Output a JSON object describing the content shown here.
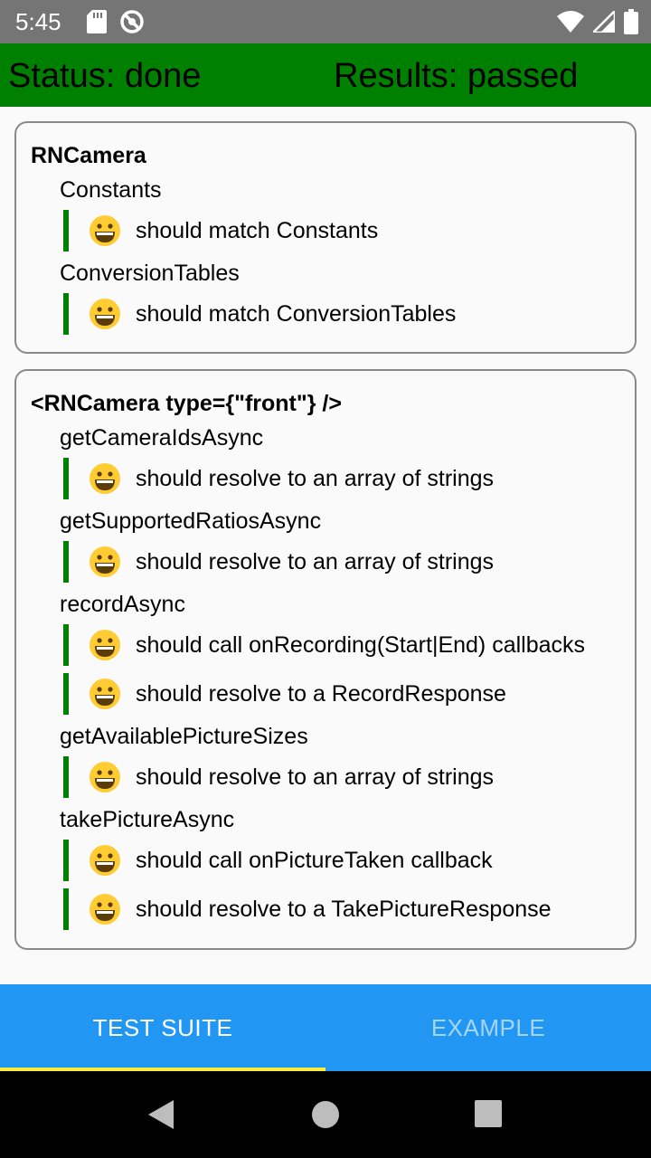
{
  "status_bar": {
    "time": "5:45",
    "icons_left": [
      "sd-card-icon",
      "no-location-icon"
    ],
    "icons_right": [
      "wifi-icon",
      "signal-icon",
      "battery-icon"
    ]
  },
  "header": {
    "status": "Status: done",
    "results": "Results: passed",
    "bg_color": "#008000"
  },
  "suites": [
    {
      "title": "RNCamera",
      "groups": [
        {
          "title": "Constants",
          "tests": [
            {
              "label": "should match Constants",
              "emoji": "grinning-face-icon"
            }
          ]
        },
        {
          "title": "ConversionTables",
          "tests": [
            {
              "label": "should match ConversionTables",
              "emoji": "grinning-face-icon"
            }
          ]
        }
      ]
    },
    {
      "title": "<RNCamera type={\"front\"} />",
      "groups": [
        {
          "title": "getCameraIdsAsync",
          "tests": [
            {
              "label": "should resolve to an array of strings"
            }
          ]
        },
        {
          "title": "getSupportedRatiosAsync",
          "tests": [
            {
              "label": "should resolve to an array of strings"
            }
          ]
        },
        {
          "title": "recordAsync",
          "tests": [
            {
              "label": "should call onRecording(Start|End) callbacks"
            },
            {
              "label": "should resolve to a RecordResponse"
            }
          ]
        },
        {
          "title": "getAvailablePictureSizes",
          "tests": [
            {
              "label": "should resolve to an array of strings"
            }
          ]
        },
        {
          "title": "takePictureAsync",
          "tests": [
            {
              "label": "should call onPictureTaken callback"
            },
            {
              "label": "should resolve to a TakePictureResponse"
            }
          ]
        }
      ]
    }
  ],
  "tabs": [
    {
      "label": "TEST SUITE",
      "active": true
    },
    {
      "label": "EXAMPLE",
      "active": false
    }
  ],
  "nav": [
    "back-icon",
    "home-icon",
    "recents-icon"
  ],
  "colors": {
    "pass": "#008000",
    "tab_bar": "#2196f3",
    "tab_indicator": "#ffeb3b"
  }
}
